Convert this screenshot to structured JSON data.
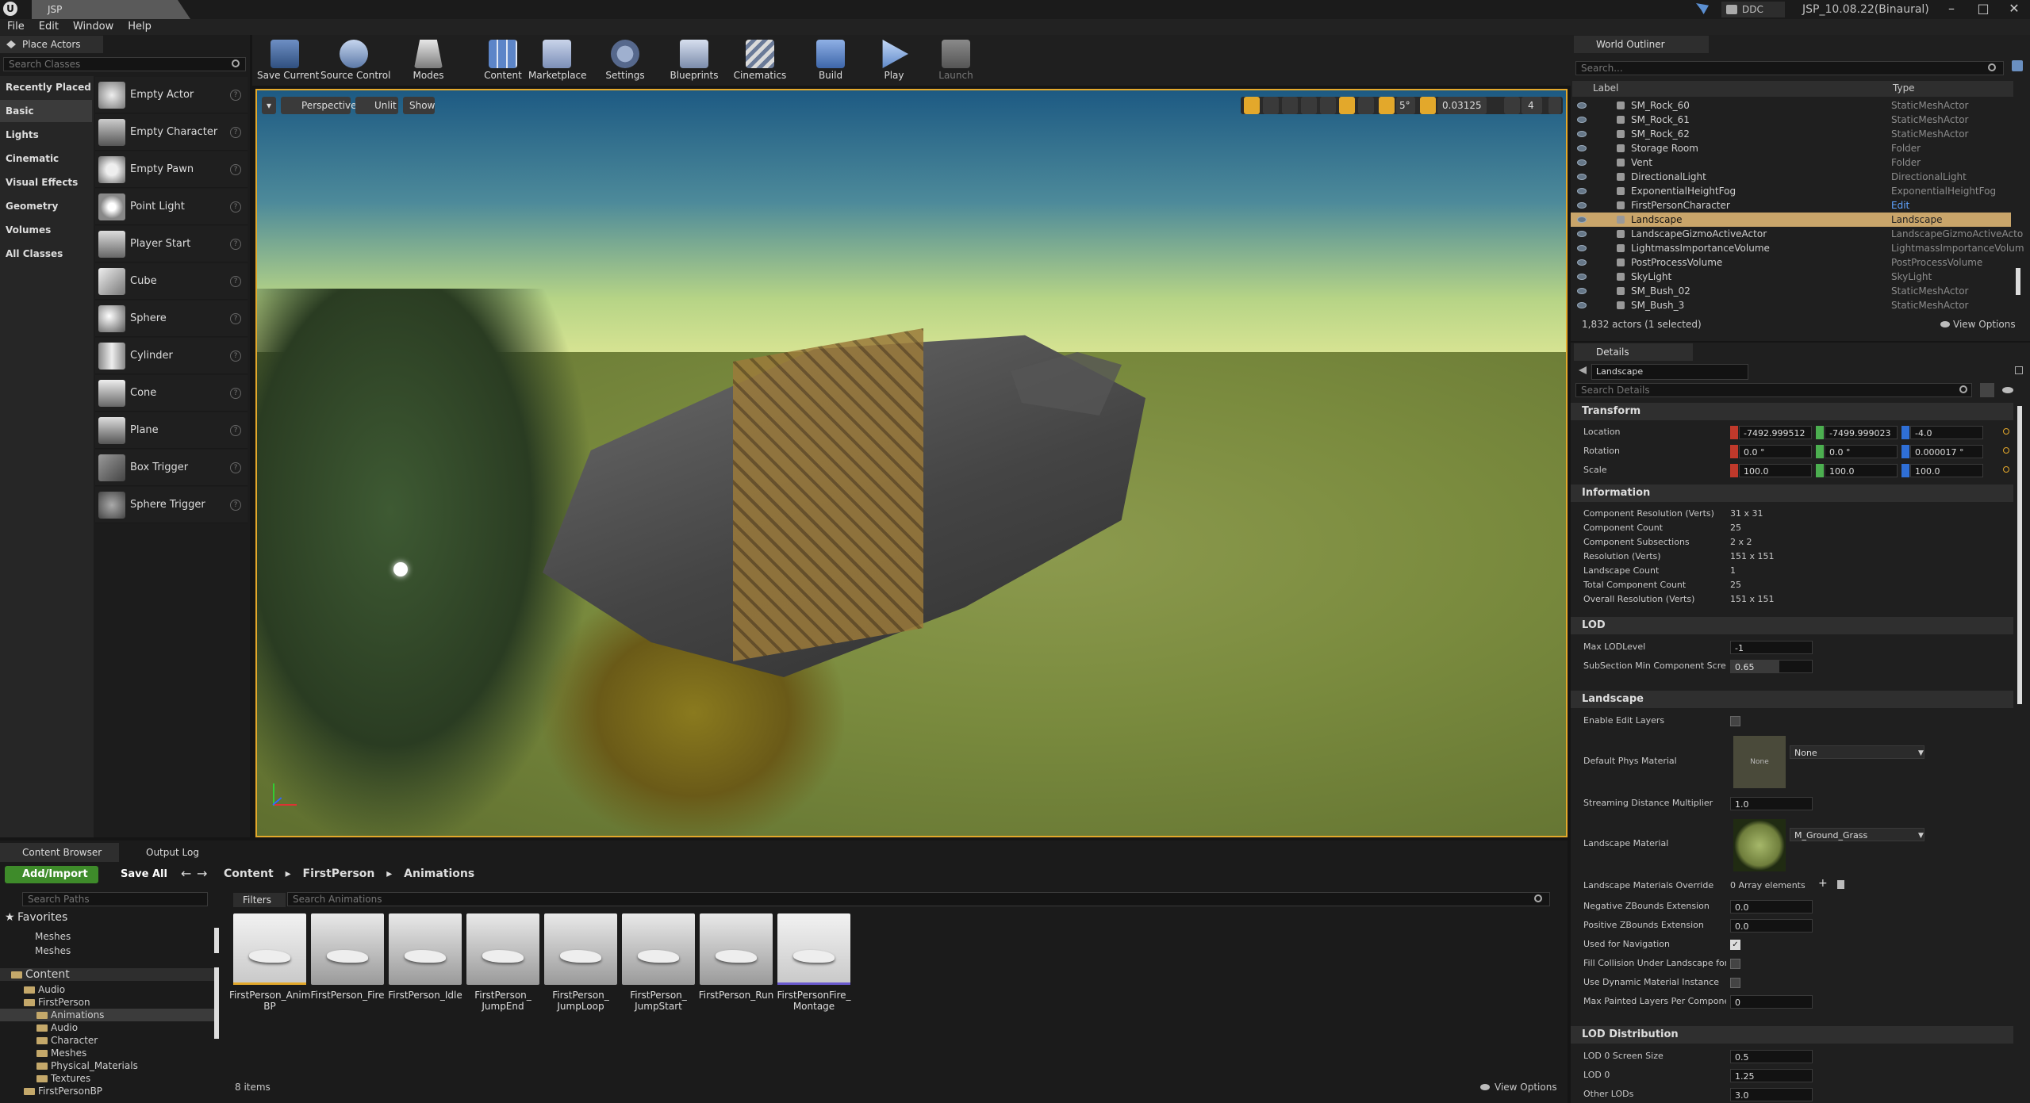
{
  "window": {
    "tab": "JSP",
    "ddc": "DDC",
    "project": "JSP_10.08.22(Binaural)"
  },
  "menu": [
    "File",
    "Edit",
    "Window",
    "Help"
  ],
  "place_actors": {
    "tab": "Place Actors",
    "search_placeholder": "Search Classes",
    "categories": [
      "Recently Placed",
      "Basic",
      "Lights",
      "Cinematic",
      "Visual Effects",
      "Geometry",
      "Volumes",
      "All Classes"
    ],
    "selected_category": "Basic",
    "actors": [
      "Empty Actor",
      "Empty Character",
      "Empty Pawn",
      "Point Light",
      "Player Start",
      "Cube",
      "Sphere",
      "Cylinder",
      "Cone",
      "Plane",
      "Box Trigger",
      "Sphere Trigger"
    ]
  },
  "toolbar": {
    "buttons": [
      "Save Current",
      "Source Control",
      "Modes",
      "Content",
      "Marketplace",
      "Settings",
      "Blueprints",
      "Cinematics",
      "Build",
      "Play",
      "Launch"
    ]
  },
  "viewport": {
    "perspective": "Perspective",
    "lit": "Unlit",
    "show": "Show",
    "angle": "5°",
    "scale": "0.03125",
    "cam_speed": "4"
  },
  "outliner": {
    "tab": "World Outliner",
    "search_placeholder": "Search...",
    "col_label": "Label",
    "col_type": "Type",
    "rows": [
      {
        "label": "SM_Rock_60",
        "type": "StaticMeshActor"
      },
      {
        "label": "SM_Rock_61",
        "type": "StaticMeshActor"
      },
      {
        "label": "SM_Rock_62",
        "type": "StaticMeshActor"
      },
      {
        "label": "Storage Room",
        "type": "Folder"
      },
      {
        "label": "Vent",
        "type": "Folder"
      },
      {
        "label": "DirectionalLight",
        "type": "DirectionalLight"
      },
      {
        "label": "ExponentialHeightFog",
        "type": "ExponentialHeightFog"
      },
      {
        "label": "FirstPersonCharacter",
        "type": "Edit FirstPersonCharacter"
      },
      {
        "label": "Landscape",
        "type": "Landscape"
      },
      {
        "label": "LandscapeGizmoActiveActor",
        "type": "LandscapeGizmoActiveActo"
      },
      {
        "label": "LightmassImportanceVolume",
        "type": "LightmassImportanceVolum"
      },
      {
        "label": "PostProcessVolume",
        "type": "PostProcessVolume"
      },
      {
        "label": "SkyLight",
        "type": "SkyLight"
      },
      {
        "label": "SM_Bush_02",
        "type": "StaticMeshActor"
      },
      {
        "label": "SM_Bush_3",
        "type": "StaticMeshActor"
      }
    ],
    "selected_index": 8,
    "count": "1,832 actors (1 selected)",
    "view_options": "View Options"
  },
  "details": {
    "tab": "Details",
    "name": "Landscape",
    "search_placeholder": "Search Details",
    "transform": {
      "header": "Transform",
      "location_label": "Location",
      "rotation_label": "Rotation",
      "scale_label": "Scale",
      "location": [
        "-7492.999512",
        "-7499.999023",
        "-4.0"
      ],
      "rotation": [
        "0.0 °",
        "0.0 °",
        "0.000017 °"
      ],
      "scale": [
        "100.0",
        "100.0",
        "100.0"
      ]
    },
    "information": {
      "header": "Information",
      "rows": [
        {
          "k": "Component Resolution (Verts)",
          "v": "31 x 31"
        },
        {
          "k": "Component Count",
          "v": "25"
        },
        {
          "k": "Component Subsections",
          "v": "2 x 2"
        },
        {
          "k": "Resolution (Verts)",
          "v": "151 x 151"
        },
        {
          "k": "Landscape Count",
          "v": "1"
        },
        {
          "k": "Total Component Count",
          "v": "25"
        },
        {
          "k": "Overall Resolution (Verts)",
          "v": "151 x 151"
        }
      ]
    },
    "lod": {
      "header": "LOD",
      "max_lod_label": "Max LODLevel",
      "max_lod": "-1",
      "subsection_label": "SubSection Min Component Screen",
      "subsection": "0.65"
    },
    "landscape": {
      "header": "Landscape",
      "enable_edit_layers": "Enable Edit Layers",
      "default_phys_material": "Default Phys Material",
      "phys_thumb": "None",
      "phys_value": "None",
      "streaming_label": "Streaming Distance Multiplier",
      "streaming": "1.0",
      "landscape_material": "Landscape Material",
      "material_value": "M_Ground_Grass",
      "override_label": "Landscape Materials Override",
      "override_value": "0 Array elements",
      "neg_z_label": "Negative ZBounds Extension",
      "neg_z": "0.0",
      "pos_z_label": "Positive ZBounds Extension",
      "pos_z": "0.0",
      "nav_label": "Used for Navigation",
      "fill_label": "Fill Collision Under Landscape for N",
      "dyn_label": "Use Dynamic Material Instance",
      "max_layers_label": "Max Painted Layers Per Component",
      "max_layers": "0"
    },
    "lod_distribution": {
      "header": "LOD Distribution",
      "lod0_screen_label": "LOD 0 Screen Size",
      "lod0_screen": "0.5",
      "lod0_label": "LOD 0",
      "lod0": "1.25",
      "other_label": "Other LODs",
      "other": "3.0"
    }
  },
  "content_browser": {
    "tab": "Content Browser",
    "output_tab": "Output Log",
    "add_import": "Add/Import",
    "save_all": "Save All",
    "path": [
      "Content",
      "FirstPerson",
      "Animations"
    ],
    "search_paths": "Search Paths",
    "filters": "Filters",
    "search_assets": "Search Animations",
    "favorites": "Favorites",
    "fav_items": [
      "Meshes",
      "Meshes"
    ],
    "tree": [
      "Content",
      "Audio",
      "FirstPerson",
      "Animations",
      "Audio",
      "Character",
      "Meshes",
      "Physical_Materials",
      "Textures",
      "FirstPersonBP"
    ],
    "assets": [
      "FirstPerson_AnimBP",
      "FirstPerson_Fire",
      "FirstPerson_Idle",
      "FirstPerson_JumpEnd",
      "FirstPerson_JumpLoop",
      "FirstPerson_JumpStart",
      "FirstPerson_Run",
      "FirstPersonFire_Montage"
    ],
    "asset_labels": [
      [
        "FirstPerson_Anim",
        "BP"
      ],
      [
        "FirstPerson_Fire",
        ""
      ],
      [
        "FirstPerson_Idle",
        ""
      ],
      [
        "FirstPerson_",
        "JumpEnd"
      ],
      [
        "FirstPerson_",
        "JumpLoop"
      ],
      [
        "FirstPerson_",
        "JumpStart"
      ],
      [
        "FirstPerson_Run",
        ""
      ],
      [
        "FirstPersonFire_",
        "Montage"
      ]
    ],
    "count": "8 items",
    "view_options": "View Options"
  }
}
